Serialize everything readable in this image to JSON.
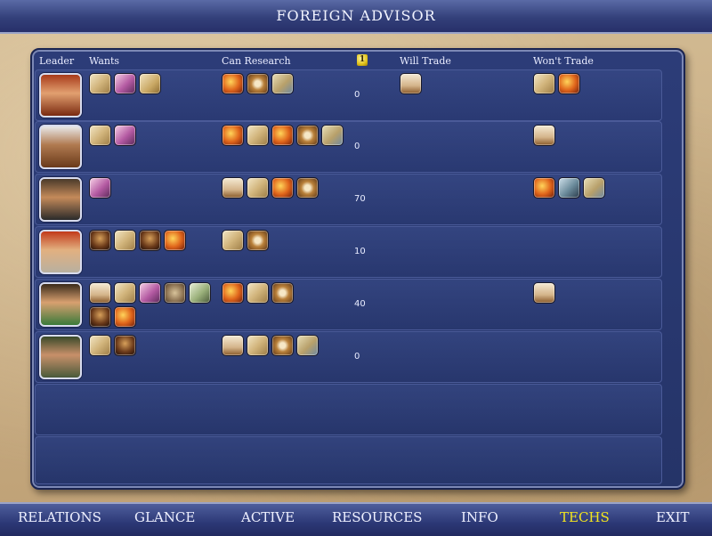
{
  "window": {
    "title": "FOREIGN ADVISOR"
  },
  "columns": {
    "leader": "Leader",
    "wants": "Wants",
    "can_research": "Can Research",
    "gold_icon": "1",
    "will_trade": "Will Trade",
    "wont_trade": "Won't Trade"
  },
  "rows": [
    {
      "leader": "leader-1",
      "gold": "0",
      "wants": [
        "book-icon",
        "pink-scroll-icon",
        "scroll-icon"
      ],
      "can_research": [
        "fire-icon",
        "compass-icon",
        "map-icon"
      ],
      "will_trade": [
        "chest-icon"
      ],
      "wont_trade": [
        "book-icon",
        "fire-icon"
      ]
    },
    {
      "leader": "leader-2",
      "gold": "0",
      "wants": [
        "book-icon",
        "pink-scroll-icon"
      ],
      "can_research": [
        "fire-icon",
        "book-icon",
        "fire-icon",
        "compass-icon",
        "map-icon"
      ],
      "will_trade": [],
      "wont_trade": [
        "chest-icon"
      ]
    },
    {
      "leader": "leader-3",
      "gold": "70",
      "wants": [
        "pink-scroll-icon"
      ],
      "can_research": [
        "chest-icon",
        "book-icon",
        "fire-icon",
        "compass-icon"
      ],
      "will_trade": [],
      "wont_trade": [
        "fire-icon",
        "grey-icon",
        "map-icon"
      ]
    },
    {
      "leader": "leader-4",
      "gold": "10",
      "wants": [
        "dark-icon",
        "book-icon",
        "dark-icon",
        "fire-icon"
      ],
      "can_research": [
        "book-icon",
        "compass-icon"
      ],
      "will_trade": [],
      "wont_trade": []
    },
    {
      "leader": "leader-5",
      "gold": "40",
      "wants": [
        "chest-icon",
        "book-icon",
        "pink-scroll-icon",
        "seed-icon",
        "money-icon",
        "dark-icon",
        "fire-icon"
      ],
      "can_research": [
        "fire-icon",
        "book-icon",
        "compass-icon"
      ],
      "will_trade": [],
      "wont_trade": [
        "chest-icon"
      ]
    },
    {
      "leader": "leader-6",
      "gold": "0",
      "wants": [
        "book-icon",
        "dark-icon"
      ],
      "can_research": [
        "chest-icon",
        "book-icon",
        "compass-icon",
        "map-icon"
      ],
      "will_trade": [],
      "wont_trade": []
    }
  ],
  "nav": {
    "relations": "RELATIONS",
    "glance": "GLANCE",
    "active": "ACTIVE",
    "resources": "RESOURCES",
    "info": "INFO",
    "techs": "TECHS",
    "exit": "EXIT"
  },
  "colors": {
    "title_bar": "#33407a",
    "panel": "#2c3c78",
    "active_nav": "#f3e51e",
    "border": "#9aa3c8"
  }
}
